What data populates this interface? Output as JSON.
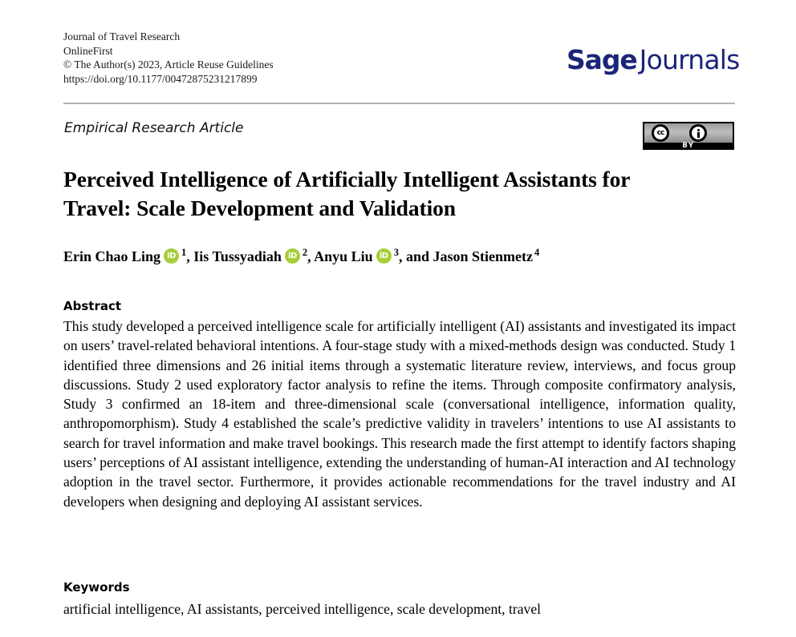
{
  "header": {
    "journal_name": "Journal of Travel Research",
    "publication_stage": "OnlineFirst",
    "copyright": "© The Author(s) 2023, Article Reuse Guidelines",
    "doi": "https://doi.org/10.1177/00472875231217899"
  },
  "logo": {
    "brand_primary": "Sage",
    "brand_secondary": "Journals",
    "brand_color": "#1b2578"
  },
  "license": {
    "cc_label": "cc",
    "by_label": "BY",
    "badge_background": "#000000"
  },
  "article": {
    "type": "Empirical Research Article",
    "title": "Perceived Intelligence of Artificially Intelligent Assistants for Travel: Scale Development and Validation"
  },
  "authors": {
    "orcid_icon_label": "iD",
    "orcid_color": "#a6ce39",
    "list": [
      {
        "name": "Erin Chao Ling",
        "has_orcid": true,
        "affiliation_marker": "1",
        "separator": ", "
      },
      {
        "name": "Iis Tussyadiah",
        "has_orcid": true,
        "affiliation_marker": "2",
        "separator": ", "
      },
      {
        "name": "Anyu Liu",
        "has_orcid": true,
        "affiliation_marker": "3",
        "separator": ", and "
      },
      {
        "name": "Jason Stienmetz",
        "has_orcid": false,
        "affiliation_marker": "4",
        "separator": ""
      }
    ]
  },
  "abstract": {
    "heading": "Abstract",
    "text": "This study developed a perceived intelligence scale for artificially intelligent (AI) assistants and investigated its impact on users’ travel-related behavioral intentions. A four-stage study with a mixed-methods design was conducted. Study 1 identified three dimensions and 26 initial items through a systematic literature review, interviews, and focus group discussions. Study 2 used exploratory factor analysis to refine the items. Through composite confirmatory analysis, Study 3 confirmed an 18-item and three-dimensional scale (conversational intelligence, information quality, anthropomorphism). Study 4 established the scale’s predictive validity in travelers’ intentions to use AI assistants to search for travel information and make travel bookings. This research made the first attempt to identify factors shaping users’ perceptions of AI assistant intelligence, extending the understanding of human-AI interaction and AI technology adoption in the travel sector. Furthermore, it provides actionable recommendations for the travel industry and AI developers when designing and deploying AI assistant services."
  },
  "keywords": {
    "heading": "Keywords",
    "text": "artificial intelligence, AI assistants, perceived intelligence, scale development, travel"
  }
}
